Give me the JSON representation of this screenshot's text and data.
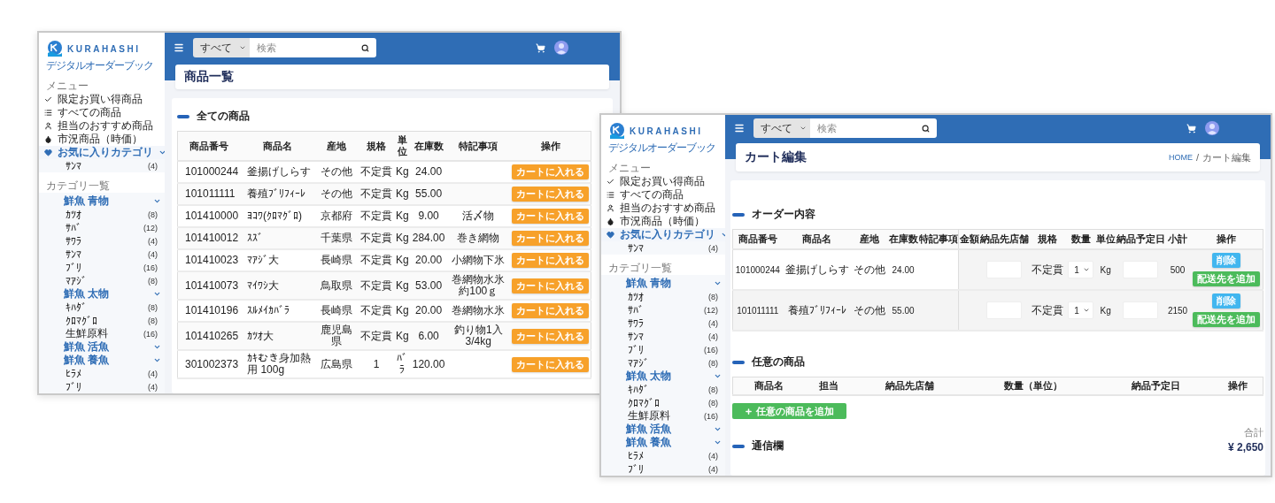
{
  "windows": [
    {
      "kind": "product_list",
      "brand": {
        "name": "KURAHASHI",
        "tagline": "デジタルオーダーブック"
      },
      "header": {
        "search_scope": "すべて",
        "search_placeholder": "検索"
      },
      "sidebar": {
        "menu_heading": "メニュー",
        "menu": [
          {
            "kind": "link",
            "label": "限定お買い得商品"
          },
          {
            "kind": "link",
            "label": "すべての商品"
          },
          {
            "kind": "link",
            "label": "担当のおすすめ商品"
          },
          {
            "kind": "link",
            "label": "市況商品（時価）"
          },
          {
            "kind": "group",
            "label": "お気に入りカテゴリ",
            "children": [
              {
                "label": "ｻﾝﾏ",
                "count": "(4)"
              }
            ]
          }
        ],
        "category_heading": "カテゴリ一覧",
        "categories": [
          {
            "label": "鮮魚 青物",
            "children": [
              {
                "label": "ｶﾂｵ",
                "count": "(8)"
              },
              {
                "label": "ｻﾊﾞ",
                "count": "(12)"
              },
              {
                "label": "ｻﾜﾗ",
                "count": "(4)"
              },
              {
                "label": "ｻﾝﾏ",
                "count": "(4)"
              },
              {
                "label": "ﾌﾞﾘ",
                "count": "(16)"
              },
              {
                "label": "ﾏｱｼﾞ",
                "count": "(8)"
              }
            ]
          },
          {
            "label": "鮮魚 太物",
            "children": [
              {
                "label": "ｷﾊﾀﾞ",
                "count": "(8)"
              },
              {
                "label": "ｸﾛﾏｸﾞﾛ",
                "count": "(8)"
              },
              {
                "label": "生鮮原料",
                "count": "(16)"
              }
            ]
          },
          {
            "label": "鮮魚 活魚"
          },
          {
            "label": "鮮魚 養魚",
            "children": [
              {
                "label": "ﾋﾗﾒ",
                "count": "(4)"
              },
              {
                "label": "ﾌﾞﾘ",
                "count": "(4)"
              }
            ]
          }
        ]
      },
      "page_title": "商品一覧",
      "section_title": "全ての商品",
      "table": {
        "columns": [
          "商品番号",
          "商品名",
          "産地",
          "規格",
          "単位",
          "在庫数",
          "特記事項",
          "操作"
        ],
        "rows": [
          {
            "number": "101000244",
            "name": "釜揚げしらす",
            "origin": "その他",
            "spec": "不定貫",
            "unit": "Kg",
            "stock": "24.00",
            "action": "カートに入れる"
          },
          {
            "number": "101011111",
            "name": "養殖ﾌﾞﾘﾌｨｰﾚ",
            "origin": "その他",
            "spec": "不定貫",
            "unit": "Kg",
            "stock": "55.00",
            "action": "カートに入れる"
          },
          {
            "number": "101410000",
            "name": "ﾖｺﾜ(ｸﾛﾏｸﾞﾛ)",
            "origin": "京都府",
            "spec": "不定貫",
            "unit": "Kg",
            "stock": "9.00",
            "note": "活〆物",
            "action": "カートに入れる"
          },
          {
            "number": "101410012",
            "name": "ｽｽﾞ",
            "origin": "千葉県",
            "spec": "不定貫",
            "unit": "Kg",
            "stock": "284.00",
            "note": "巻き網物",
            "action": "カートに入れる"
          },
          {
            "number": "101410023",
            "name": "ﾏｱｼﾞ大",
            "origin": "長崎県",
            "spec": "不定貫",
            "unit": "Kg",
            "stock": "20.00",
            "note": "小網物下氷",
            "action": "カートに入れる"
          },
          {
            "number": "101410073",
            "name": "ﾏｲﾜｼ大",
            "origin": "鳥取県",
            "spec": "不定貫",
            "unit": "Kg",
            "stock": "53.00",
            "note": "巻網物水氷約100ｇ",
            "action": "カートに入れる"
          },
          {
            "number": "101410196",
            "name": "ｽﾙﾒｲｶﾊﾞﾗ",
            "origin": "長崎県",
            "spec": "不定貫",
            "unit": "Kg",
            "stock": "20.00",
            "note": "巻網物水氷",
            "action": "カートに入れる"
          },
          {
            "number": "101410265",
            "name": "ｶﾂｵ大",
            "origin": "鹿児島県",
            "spec": "不定貫",
            "unit": "Kg",
            "stock": "6.00",
            "note": "釣り物1入3/4kg",
            "action": "カートに入れる"
          },
          {
            "number": "301002373",
            "name": "ｶｷむき身加熱用 100g",
            "origin": "広島県",
            "spec": "1",
            "unit": "ﾊﾞﾗ",
            "stock": "120.00",
            "action": "カートに入れる"
          }
        ]
      }
    },
    {
      "kind": "cart_edit",
      "brand": {
        "name": "KURAHASHI",
        "tagline": "デジタルオーダーブック"
      },
      "header": {
        "search_scope": "すべて",
        "search_placeholder": "検索"
      },
      "sidebar": {
        "menu_heading": "メニュー",
        "menu": [
          {
            "kind": "link",
            "label": "限定お買い得商品"
          },
          {
            "kind": "link",
            "label": "すべての商品"
          },
          {
            "kind": "link",
            "label": "担当のおすすめ商品"
          },
          {
            "kind": "link",
            "label": "市況商品（時価）"
          },
          {
            "kind": "group",
            "label": "お気に入りカテゴリ",
            "children": [
              {
                "label": "ｻﾝﾏ",
                "count": "(4)"
              }
            ]
          }
        ],
        "category_heading": "カテゴリ一覧",
        "categories": [
          {
            "label": "鮮魚 青物",
            "children": [
              {
                "label": "ｶﾂｵ",
                "count": "(8)"
              },
              {
                "label": "ｻﾊﾞ",
                "count": "(12)"
              },
              {
                "label": "ｻﾜﾗ",
                "count": "(4)"
              },
              {
                "label": "ｻﾝﾏ",
                "count": "(4)"
              },
              {
                "label": "ﾌﾞﾘ",
                "count": "(16)"
              },
              {
                "label": "ﾏｱｼﾞ",
                "count": "(8)"
              }
            ]
          },
          {
            "label": "鮮魚 太物",
            "children": [
              {
                "label": "ｷﾊﾀﾞ",
                "count": "(8)"
              },
              {
                "label": "ｸﾛﾏｸﾞﾛ",
                "count": "(8)"
              },
              {
                "label": "生鮮原料",
                "count": "(16)"
              }
            ]
          },
          {
            "label": "鮮魚 活魚"
          },
          {
            "label": "鮮魚 養魚",
            "children": [
              {
                "label": "ﾋﾗﾒ",
                "count": "(4)"
              },
              {
                "label": "ﾌﾞﾘ",
                "count": "(4)"
              }
            ]
          }
        ]
      },
      "page_title": "カート編集",
      "breadcrumb": {
        "home": "HOME",
        "separator": "/",
        "current": "カート編集"
      },
      "order": {
        "title": "オーダー内容",
        "columns": [
          "商品番号",
          "商品名",
          "産地",
          "在庫数",
          "特記事項",
          "金額",
          "納品先店舗",
          "規格",
          "数量",
          "単位",
          "納品予定日",
          "小計",
          "操作"
        ],
        "rows": [
          {
            "number": "101000244",
            "name": "釜揚げしらす",
            "origin": "その他",
            "stock": "24.00",
            "spec": "不定貫",
            "quantity": "1",
            "unit": "Kg",
            "subtotal": "500",
            "delete": "削除",
            "add_destination": "配送先を追加"
          },
          {
            "number": "101011111",
            "name": "養殖ﾌﾞﾘﾌｨｰﾚ",
            "origin": "その他",
            "stock": "55.00",
            "spec": "不定貫",
            "quantity": "1",
            "unit": "Kg",
            "subtotal": "2150",
            "delete": "削除",
            "add_destination": "配送先を追加"
          }
        ]
      },
      "optional": {
        "title": "任意の商品",
        "columns": [
          "商品名",
          "担当",
          "納品先店舗",
          "数量（単位）",
          "納品予定日",
          "操作"
        ],
        "add_button": "任意の商品を追加"
      },
      "total": {
        "label": "合計",
        "amount": "¥ 2,650"
      },
      "message_title": "通信欄"
    }
  ]
}
